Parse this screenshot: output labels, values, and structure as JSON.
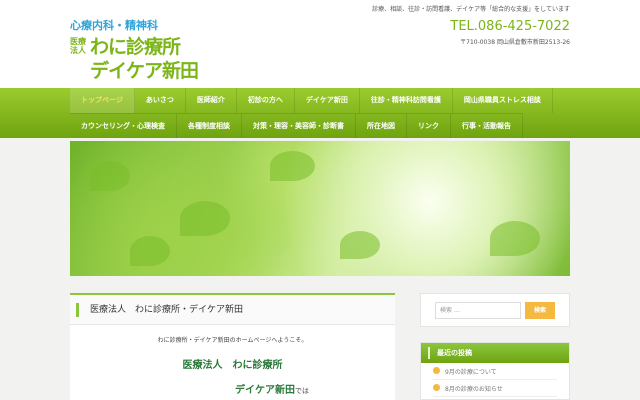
{
  "header": {
    "logo_sub": "心療内科・精神科",
    "logo_hojin": "医療法人",
    "logo_main": "わに診療所",
    "logo_main2": "デイケア新田",
    "tagline": "診療、相談、往診・訪問看護、デイケア等「総合的な支援」をしています",
    "tel": "TEL.086-425-7022",
    "address": "〒710-0038 岡山県倉敷市新田2513-26"
  },
  "nav": {
    "row1": [
      "トップページ",
      "あいさつ",
      "医師紹介",
      "初診の方へ",
      "デイケア新田",
      "往診・精神科訪問看護",
      "岡山県職員ストレス相談"
    ],
    "row2": [
      "カウンセリング・心理検査",
      "各種制度相談",
      "対策・理容・美容師・診断書",
      "所在地図",
      "リンク",
      "行事・活動報告"
    ]
  },
  "main": {
    "title": "医療法人　わに診療所・デイケア新田",
    "welcome": "わに診療所・デイケア新田のホームページへようこそ。",
    "clinic": "医療法人　わに診療所",
    "daycare": "デイケア新田",
    "daycare_suffix": "では"
  },
  "sidebar": {
    "search_placeholder": "検索 …",
    "search_button": "検索",
    "recent_title": "最近の投稿",
    "posts": [
      "9月の診療について",
      "8月の診療のお知らせ"
    ]
  },
  "colors": {
    "accent": "#7cb518",
    "button": "#f5b840"
  }
}
